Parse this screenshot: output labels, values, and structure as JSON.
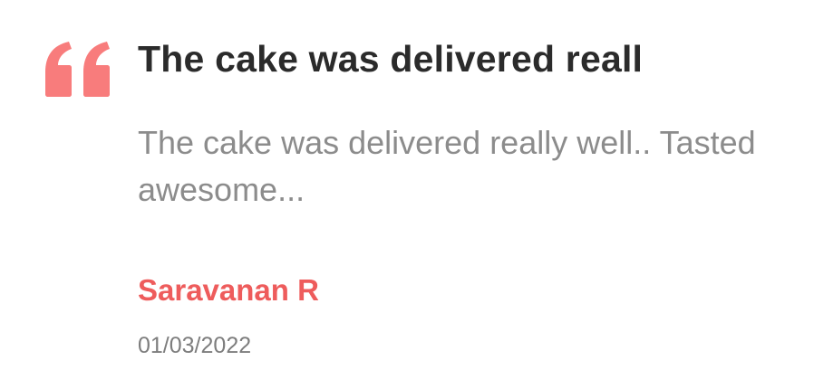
{
  "review": {
    "title": "The cake was delivered reall",
    "body": "The cake was delivered really well.. Tasted awesome...",
    "reviewer_name": "Saravanan R",
    "date": "01/03/2022"
  },
  "icons": {
    "quote": "quote-icon"
  },
  "colors": {
    "quote_icon": "#f87c7c",
    "title": "#2b2b2b",
    "body": "#8c8c8c",
    "reviewer_name": "#ee5c5c",
    "date": "#7d7d7d"
  }
}
